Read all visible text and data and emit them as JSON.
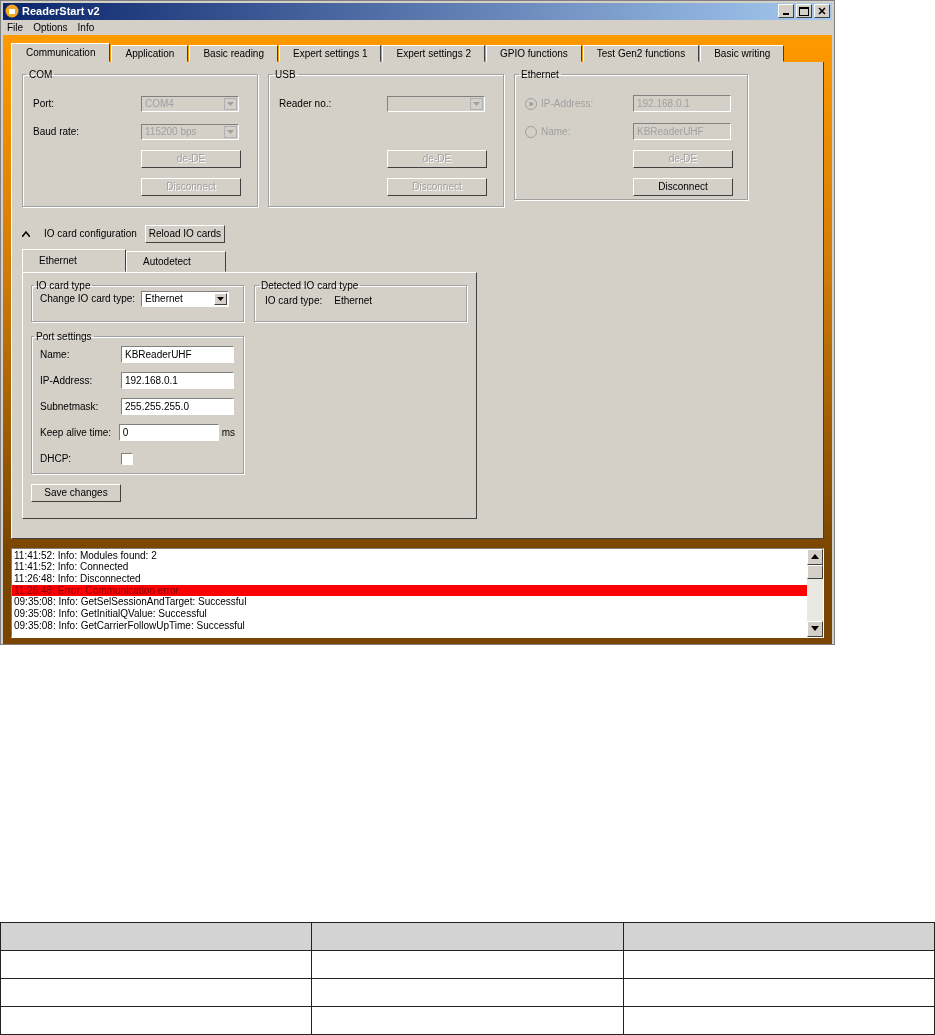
{
  "window": {
    "title": "ReaderStart v2"
  },
  "menu": [
    "File",
    "Options",
    "Info"
  ],
  "tabs": [
    {
      "label": "Communication",
      "selected": true
    },
    {
      "label": "Application",
      "selected": false
    },
    {
      "label": "Basic reading",
      "selected": false
    },
    {
      "label": "Expert settings 1",
      "selected": false
    },
    {
      "label": "Expert settings 2",
      "selected": false
    },
    {
      "label": "GPIO functions",
      "selected": false
    },
    {
      "label": "Test Gen2 functions",
      "selected": false
    },
    {
      "label": "Basic writing",
      "selected": false
    }
  ],
  "com": {
    "title": "COM",
    "fields": [
      {
        "label": "Port:",
        "value": "COM4",
        "disabled": true
      },
      {
        "label": "Baud rate:",
        "value": "115200 bps",
        "disabled": true
      }
    ],
    "buttons": [
      {
        "label": "de-DE",
        "disabled": true
      },
      {
        "label": "Disconnect",
        "disabled": true
      }
    ]
  },
  "usb": {
    "title": "USB",
    "fields": [
      {
        "label": "Reader no.:",
        "disabled": true
      }
    ],
    "buttons": [
      {
        "label": "de-DE",
        "disabled": true
      },
      {
        "label": "Disconnect",
        "disabled": true
      }
    ]
  },
  "ethernet": {
    "title": "Ethernet",
    "options": [
      {
        "label": "IP-Address:",
        "value": "192.168.0.1",
        "selected": true,
        "disabled": true
      },
      {
        "label": "Name:",
        "value": "KBReaderUHF",
        "selected": false,
        "disabled": true
      }
    ],
    "buttons": [
      {
        "label": "de-DE",
        "disabled": true
      },
      {
        "label": "Disconnect",
        "disabled": false
      }
    ]
  },
  "io_config": {
    "label": "IO card configuration",
    "expanded": true,
    "reload_button": "Reload IO cards",
    "tabs": [
      {
        "label": "Ethernet",
        "selected": true
      },
      {
        "label": "Autodetect",
        "selected": false
      }
    ],
    "card_type": {
      "title": "IO card type",
      "label": "Change IO card type:",
      "value": "Ethernet"
    },
    "detected": {
      "title": "Detected IO card type",
      "label": "IO card type:",
      "value": "Ethernet"
    },
    "port_settings": {
      "title": "Port settings",
      "fields": [
        {
          "label": "Name:",
          "value": "KBReaderUHF"
        },
        {
          "label": "IP-Address:",
          "value": "192.168.0.1"
        },
        {
          "label": "Subnetmask:",
          "value": "255.255.255.0"
        },
        {
          "label": "Keep alive time:",
          "value": "0",
          "unit": "ms"
        }
      ],
      "dhcp": {
        "label": "DHCP:",
        "checked": false
      }
    },
    "save_button": "Save changes"
  },
  "log": [
    {
      "text": "11:41:52: Info: Modules found: 2",
      "kind": "info"
    },
    {
      "text": "11:41:52: Info: Connected",
      "kind": "info"
    },
    {
      "text": "11:26:48: Info: Disconnected",
      "kind": "info"
    },
    {
      "text": "11:26:48: Error: Communication error",
      "kind": "error"
    },
    {
      "text": "09:35:08: Info: GetSelSessionAndTarget: Successful",
      "kind": "info"
    },
    {
      "text": "09:35:08: Info: GetInitialQValue: Successful",
      "kind": "info"
    },
    {
      "text": "09:35:08: Info: GetCarrierFollowUpTime: Successful",
      "kind": "info"
    }
  ]
}
